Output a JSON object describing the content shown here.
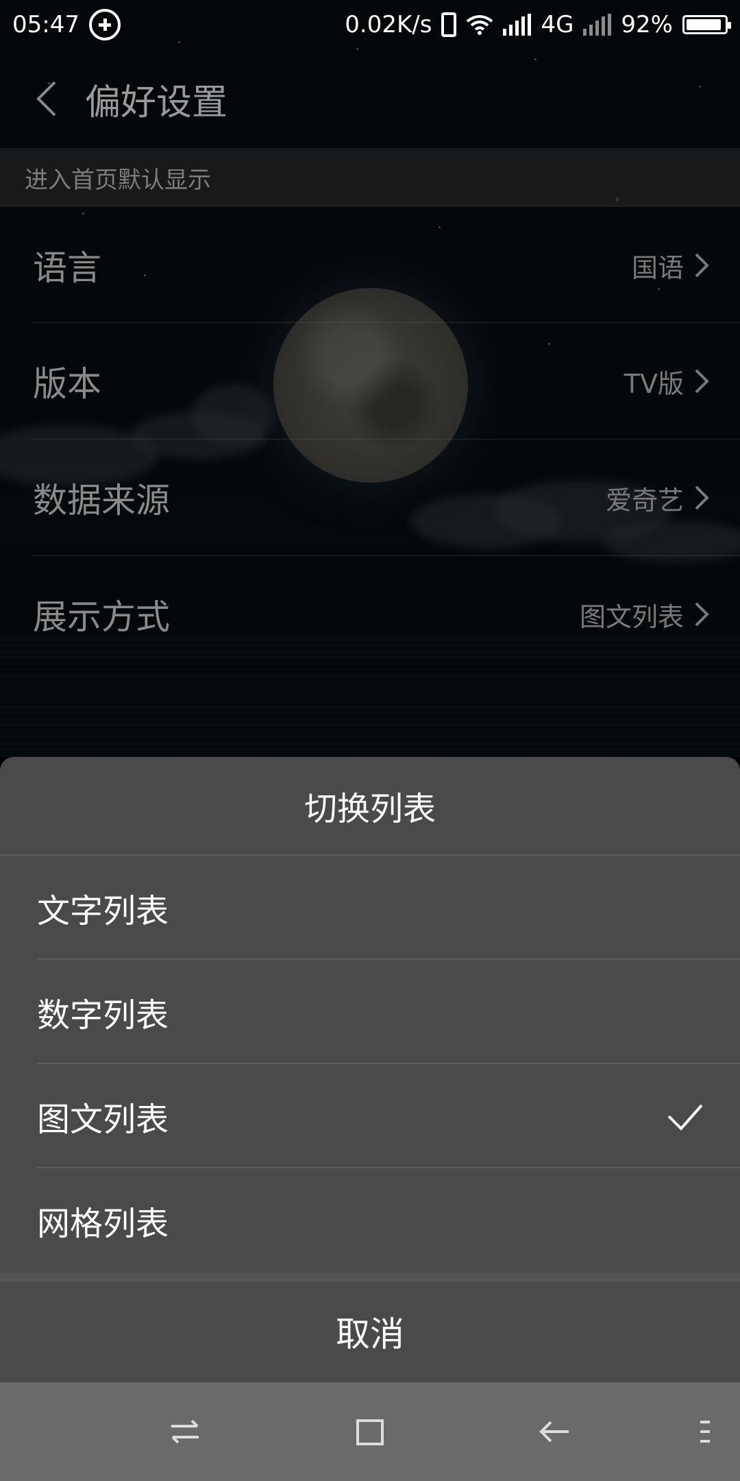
{
  "status_bar": {
    "time": "05:47",
    "net_speed": "0.02K/s",
    "network_type": "4G",
    "battery_percent": "92%",
    "battery_level": 0.92
  },
  "header": {
    "title": "偏好设置"
  },
  "section": {
    "title": "进入首页默认显示"
  },
  "settings": [
    {
      "label": "语言",
      "value": "国语"
    },
    {
      "label": "版本",
      "value": "TV版"
    },
    {
      "label": "数据来源",
      "value": "爱奇艺"
    },
    {
      "label": "展示方式",
      "value": "图文列表"
    }
  ],
  "sheet": {
    "title": "切换列表",
    "options": [
      {
        "label": "文字列表",
        "selected": false
      },
      {
        "label": "数字列表",
        "selected": false
      },
      {
        "label": "图文列表",
        "selected": true
      },
      {
        "label": "网格列表",
        "selected": false
      }
    ],
    "cancel_label": "取消"
  },
  "icons": {
    "status_left": "plus-circle-icon",
    "back": "chevron-left-icon",
    "row_arrow": "chevron-right-icon",
    "selected": "checkmark-icon",
    "nav": [
      "switch-arrows-icon",
      "square-home-icon",
      "back-arrow-icon",
      "menu-icon"
    ]
  }
}
